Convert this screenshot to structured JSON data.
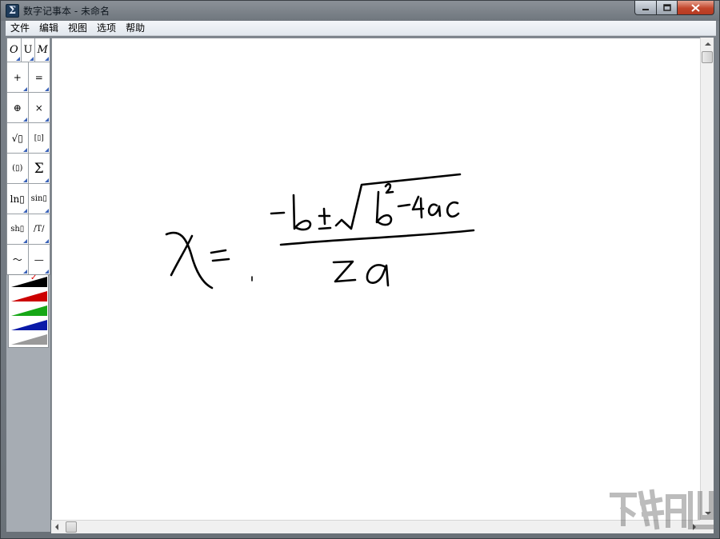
{
  "window": {
    "title": "数字记事本 - 未命名",
    "app_icon": "Σ"
  },
  "menu": {
    "items": [
      "文件",
      "编辑",
      "视图",
      "选项",
      "帮助"
    ]
  },
  "palette": {
    "style_row": [
      "O",
      "U",
      "M"
    ],
    "tools": [
      [
        "+",
        "="
      ],
      [
        "⊕",
        "×"
      ],
      [
        "√▯",
        "[▯]"
      ],
      [
        "(▯)",
        "Σ"
      ],
      [
        "ln▯",
        "sin▯"
      ],
      [
        "sh▯",
        "/T/"
      ],
      [
        "〜",
        "—"
      ]
    ],
    "colors": [
      "#000000",
      "#cc0000",
      "#16a716",
      "#0a1aa8",
      "#9a9a9a"
    ],
    "selected_color": 0
  },
  "icons": {
    "min": "minimize-icon",
    "max": "maximize-icon",
    "close": "close-icon"
  }
}
